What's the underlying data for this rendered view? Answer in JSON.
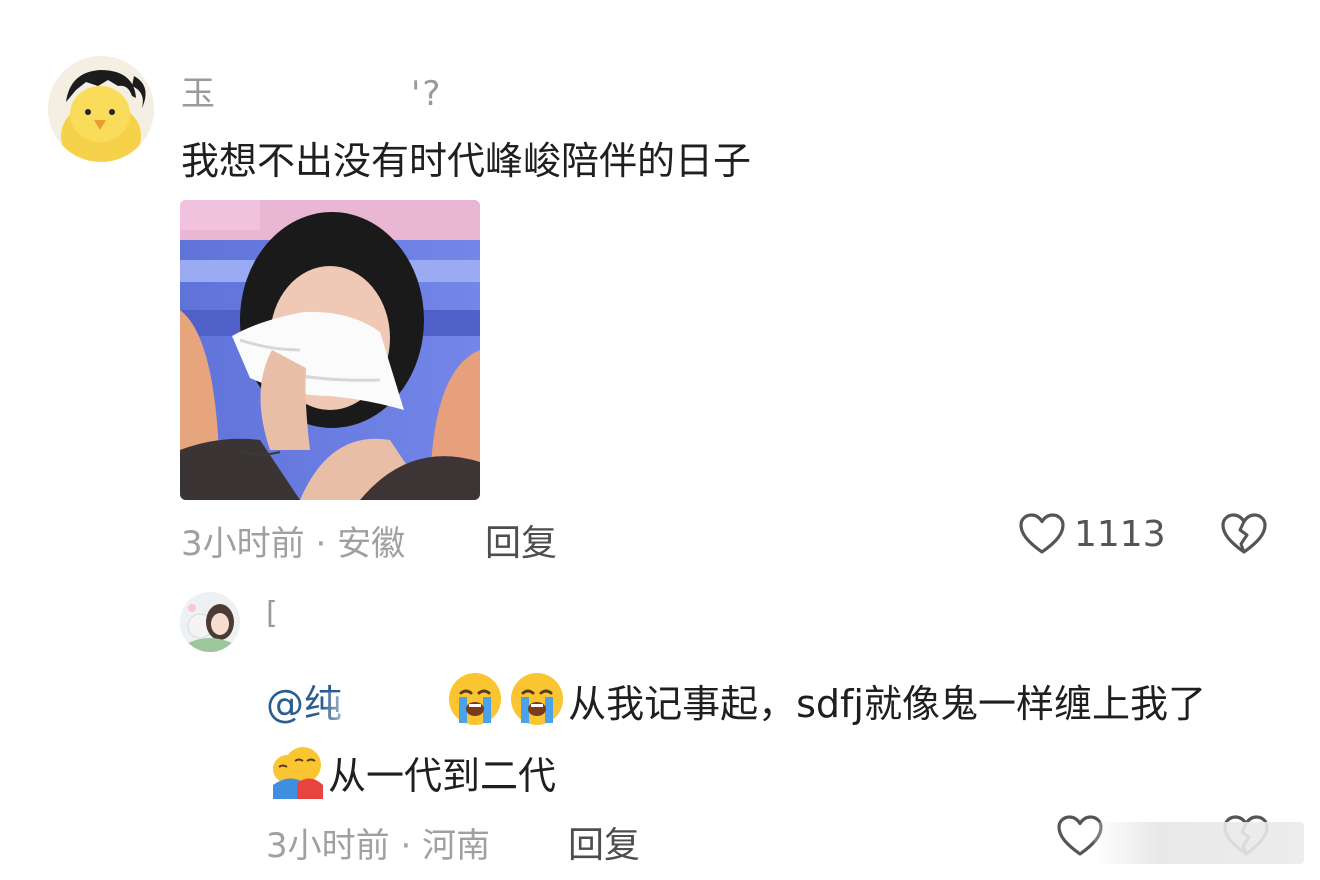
{
  "comment": {
    "username_visible": "玉",
    "username_tail": "'?",
    "text": "我想不出没有时代峰峻陪伴的日子",
    "time": "3小时前",
    "location": "安徽",
    "meta_separator": "·",
    "reply_label": "回复",
    "like_count": "1113",
    "like_icon": "heart-outline-icon",
    "dislike_icon": "broken-heart-icon",
    "sticker": "crying-woman-tissue-sticker"
  },
  "reply": {
    "username_visible": "[",
    "mention_prefix": "@纯",
    "emoji_1": "loudly-crying-face-emoji",
    "emoji_2": "loudly-crying-face-emoji",
    "text_part1": "从我记事起，sdfj就像鬼一样缠上我了",
    "emoji_3": "hugging-emoji",
    "text_part2": "从一代到二代",
    "time": "3小时前",
    "location": "河南",
    "meta_separator": "·",
    "reply_label": "回复",
    "like_icon": "heart-outline-icon",
    "dislike_icon": "broken-heart-icon"
  },
  "colors": {
    "text_primary": "#1f1f1f",
    "text_meta": "#a0a0a0",
    "mention": "#2a5d8f",
    "icon": "#555555"
  }
}
